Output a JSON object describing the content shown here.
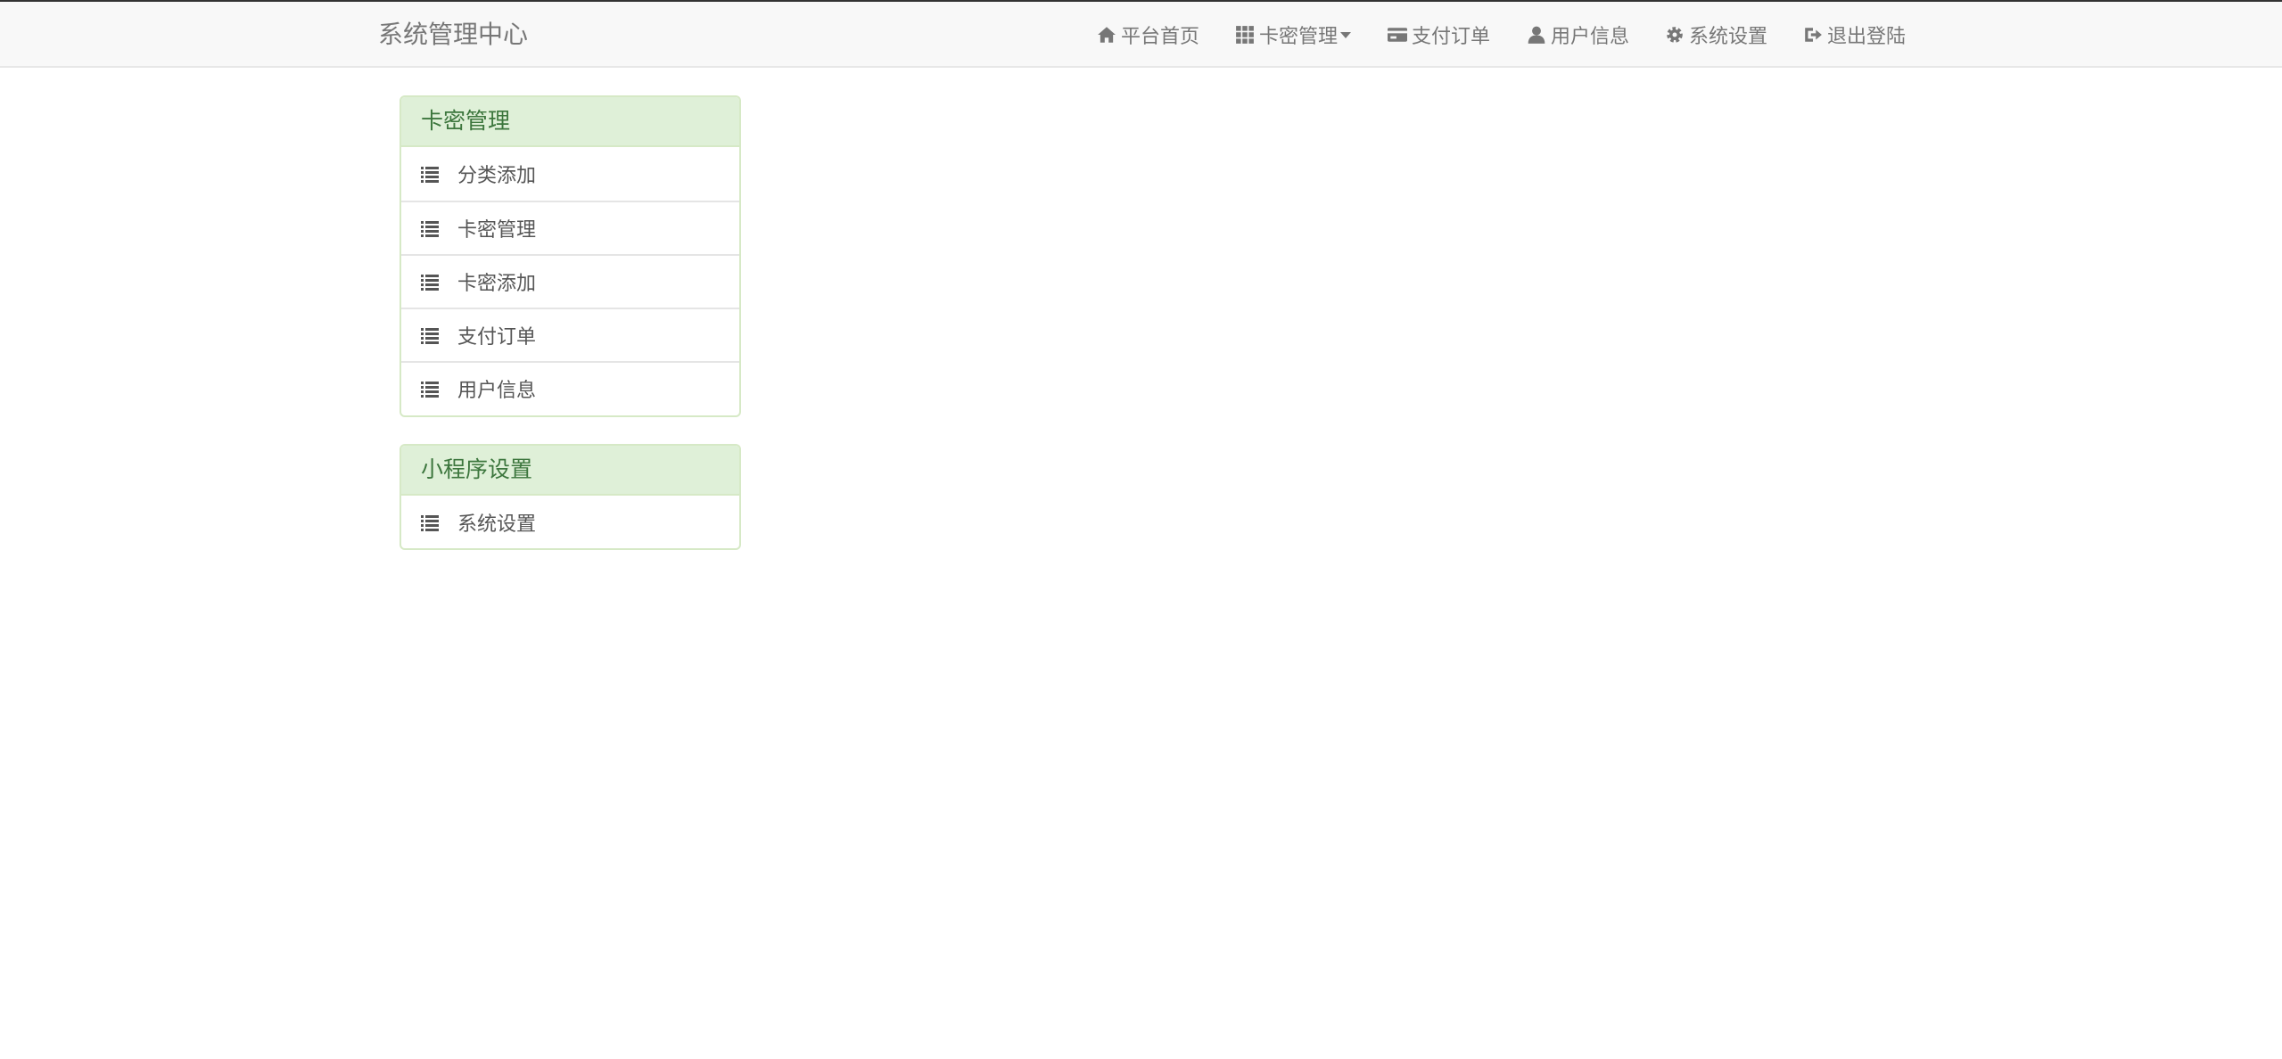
{
  "brand": "系统管理中心",
  "nav": {
    "home": "平台首页",
    "card_mgmt": "卡密管理",
    "orders": "支付订单",
    "user_info": "用户信息",
    "settings": "系统设置",
    "logout": "退出登陆"
  },
  "panels": [
    {
      "heading": "卡密管理",
      "items": [
        {
          "label": "分类添加",
          "icon": "list-icon"
        },
        {
          "label": "卡密管理",
          "icon": "list-icon"
        },
        {
          "label": "卡密添加",
          "icon": "list-icon"
        },
        {
          "label": "支付订单",
          "icon": "list-icon"
        },
        {
          "label": "用户信息",
          "icon": "list-icon"
        }
      ]
    },
    {
      "heading": "小程序设置",
      "items": [
        {
          "label": "系统设置",
          "icon": "list-icon"
        }
      ]
    }
  ],
  "colors": {
    "navbar_bg": "#f8f8f8",
    "nav_text": "#777777",
    "panel_heading_bg": "#dff0d8",
    "panel_heading_text": "#3c763d",
    "panel_border": "#d6e9c6",
    "list_text": "#555555"
  }
}
